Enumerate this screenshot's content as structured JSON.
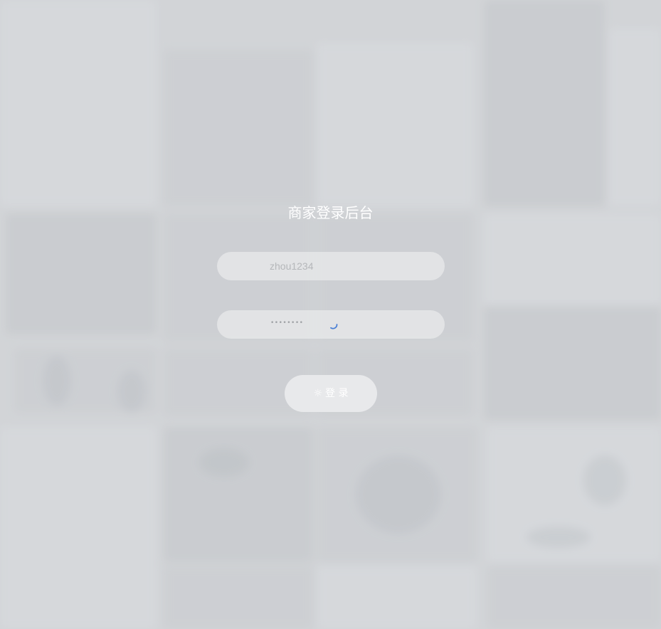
{
  "login": {
    "title": "商家登录后台",
    "username": {
      "value": "zhou1234"
    },
    "password": {
      "masked_value": "••••••••",
      "loading": true
    },
    "submit": {
      "icon": "gear-icon",
      "label": "登 录"
    }
  },
  "colors": {
    "background": "#d3d5d8",
    "field": "#e8e9eb",
    "spinner": "#4a7fd6",
    "title": "#ffffff"
  }
}
